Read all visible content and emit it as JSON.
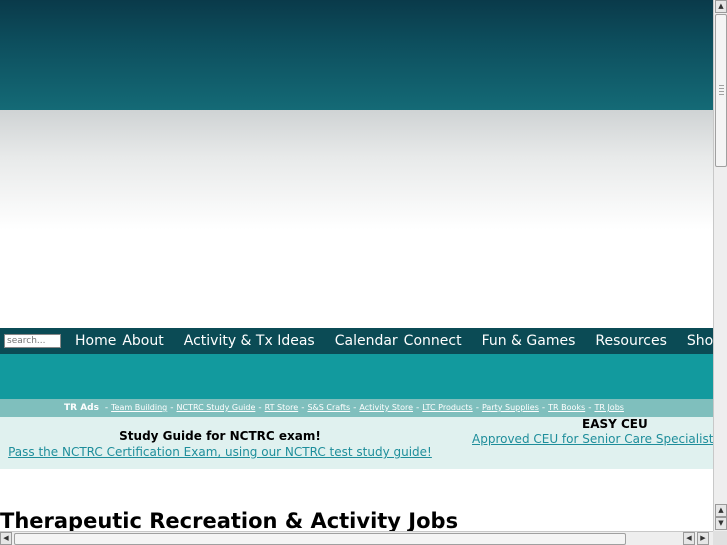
{
  "search": {
    "placeholder": "search..."
  },
  "nav": {
    "items": [
      {
        "label": "Home"
      },
      {
        "label": "About"
      },
      {
        "label": "Activity & Tx Ideas"
      },
      {
        "label": "Calendar"
      },
      {
        "label": "Connect"
      },
      {
        "label": "Fun & Games"
      },
      {
        "label": "Resources"
      },
      {
        "label": "Shop"
      }
    ]
  },
  "ads": {
    "label": "TR Ads",
    "links": [
      "Team Building",
      "NCTRC Study Guide",
      "RT Store",
      "S&S Crafts",
      "Activity Store",
      "LTC Products",
      "Party Supplies",
      "TR Books",
      "TR Jobs"
    ]
  },
  "promo": {
    "left": {
      "title": "Study Guide for NCTRC exam!",
      "link": "Pass the NCTRC Certification Exam, using our NCTRC test study guide!"
    },
    "right": {
      "title": "EASY CEU",
      "link": "Approved CEU for Senior Care Specialists a"
    }
  },
  "page": {
    "title": "Therapeutic Recreation & Activity Jobs"
  },
  "colors": {
    "header": "#0b4b55",
    "teal": "#129a9e",
    "ads_bar": "#7fbfbd",
    "promo_bg": "#e0f1ef",
    "link": "#1e8e9b"
  },
  "scroll": {
    "vertical_fraction": 0.05,
    "horizontal_fraction": 0.0
  }
}
